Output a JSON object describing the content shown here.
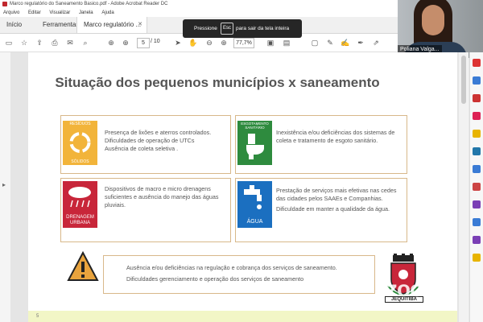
{
  "window": {
    "title": "Marco regulatório do Saneamento Basico.pdf - Adobe Acrobat Reader DC"
  },
  "menu": [
    "Arquivo",
    "Editar",
    "Visualizar",
    "Janela",
    "Ajuda"
  ],
  "tabs": [
    {
      "label": "Início"
    },
    {
      "label": "Ferramentas"
    },
    {
      "label": "Marco regulatório ...",
      "close": "✕"
    }
  ],
  "toolbar": {
    "page_current": "5",
    "page_total": "/ 10",
    "zoom": "77,7%"
  },
  "fullscreen_banner": {
    "prefix": "Pressione",
    "key": "Esc",
    "suffix": "para sair da tela inteira"
  },
  "video": {
    "participant": "Poliana Valga..."
  },
  "slide": {
    "title": "Situação dos pequenos municípios x saneamento",
    "cards": [
      {
        "icon_label_top": "RESÍDUOS",
        "icon_label_bottom": "SÓLIDOS",
        "lines": [
          "Presença de lixões e aterros controlados.",
          "Dificuldades de operação de UTCs",
          "Ausência de coleta seletiva ."
        ]
      },
      {
        "icon_label_top": "ESGOTAMENTO SANITÁRIO",
        "lines": [
          "Inexistência e/ou deficiências dos sistemas de coleta e tratamento de esgoto sanitário."
        ]
      },
      {
        "icon_label_bottom": "DRENAGEM URBANA",
        "lines": [
          "Dispositivos de macro e micro drenagens suficientes e ausência do manejo das águas pluviais."
        ]
      },
      {
        "icon_label_bottom": "ÁGUA",
        "lines": [
          "Prestação de serviços mais efetivas nas cedes das cidades pelos SAAEs e Companhias.",
          "Dificuldade em manter a qualidade da água."
        ]
      }
    ],
    "bottom_card": {
      "lines": [
        "Ausência e/ou deficiências  na regulação e cobrança dos serviços de saneamento.",
        "Dificuldades gerenciamento e operação dos serviços de saneamento"
      ]
    },
    "crest_label": "JEQUITIBÁ",
    "page_number": "5"
  },
  "watermark": "zoom",
  "colors": {
    "residuos": "#f2b43a",
    "esgoto": "#2e8b3e",
    "drenagem": "#c8263a",
    "agua": "#1b6fc0",
    "card_border": "#d8b88a",
    "warning": "#e8a33d"
  },
  "icons": {
    "recycle": "recycle-icon",
    "toilet": "toilet-icon",
    "rain": "rain-cloud-icon",
    "tap": "water-tap-icon",
    "warning": "warning-icon"
  }
}
